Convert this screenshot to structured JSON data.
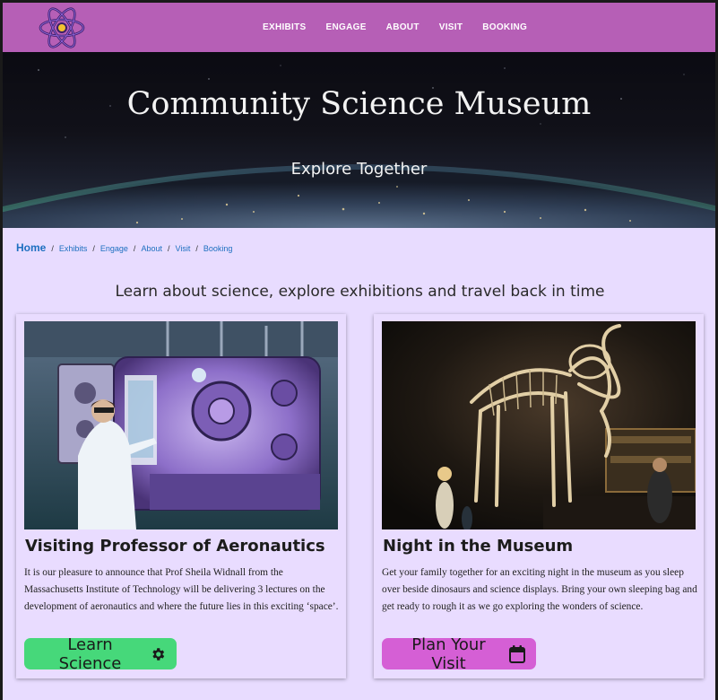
{
  "nav": {
    "logo_icon": "atom-icon",
    "links": [
      "EXHIBITS",
      "ENGAGE",
      "ABOUT",
      "VISIT",
      "BOOKING"
    ]
  },
  "hero": {
    "title": "Community Science Museum",
    "subtitle": "Explore Together"
  },
  "breadcrumb": {
    "home": "Home",
    "items": [
      "Exhibits",
      "Engage",
      "About",
      "Visit",
      "Booking"
    ],
    "separator": "/"
  },
  "tagline": "Learn about science, explore exhibitions and travel back in time",
  "cards": [
    {
      "title": "Visiting Professor of Aeronautics",
      "body": "It is our pleasure to announce that Prof Sheila Widnall from the Massachusetts Institute of Technology will be delivering 3 lectures on the development of aeronautics and where the future lies in this exciting ‘space’.",
      "button_label": "Learn Science",
      "button_icon": "gear-icon",
      "button_color": "#46d87a"
    },
    {
      "title": "Night in the Museum",
      "body": "Get your family together for an exciting night in the museum as you sleep over beside dinosaurs and science displays. Bring your own sleeping bag and get ready to rough it as we go exploring the wonders of science.",
      "button_label": "Plan Your Visit",
      "button_icon": "calendar-icon",
      "button_color": "#d55fd5"
    }
  ],
  "colors": {
    "nav_bg": "#b65fb6",
    "page_bg": "#e8dcff",
    "link": "#1d6fc0"
  }
}
